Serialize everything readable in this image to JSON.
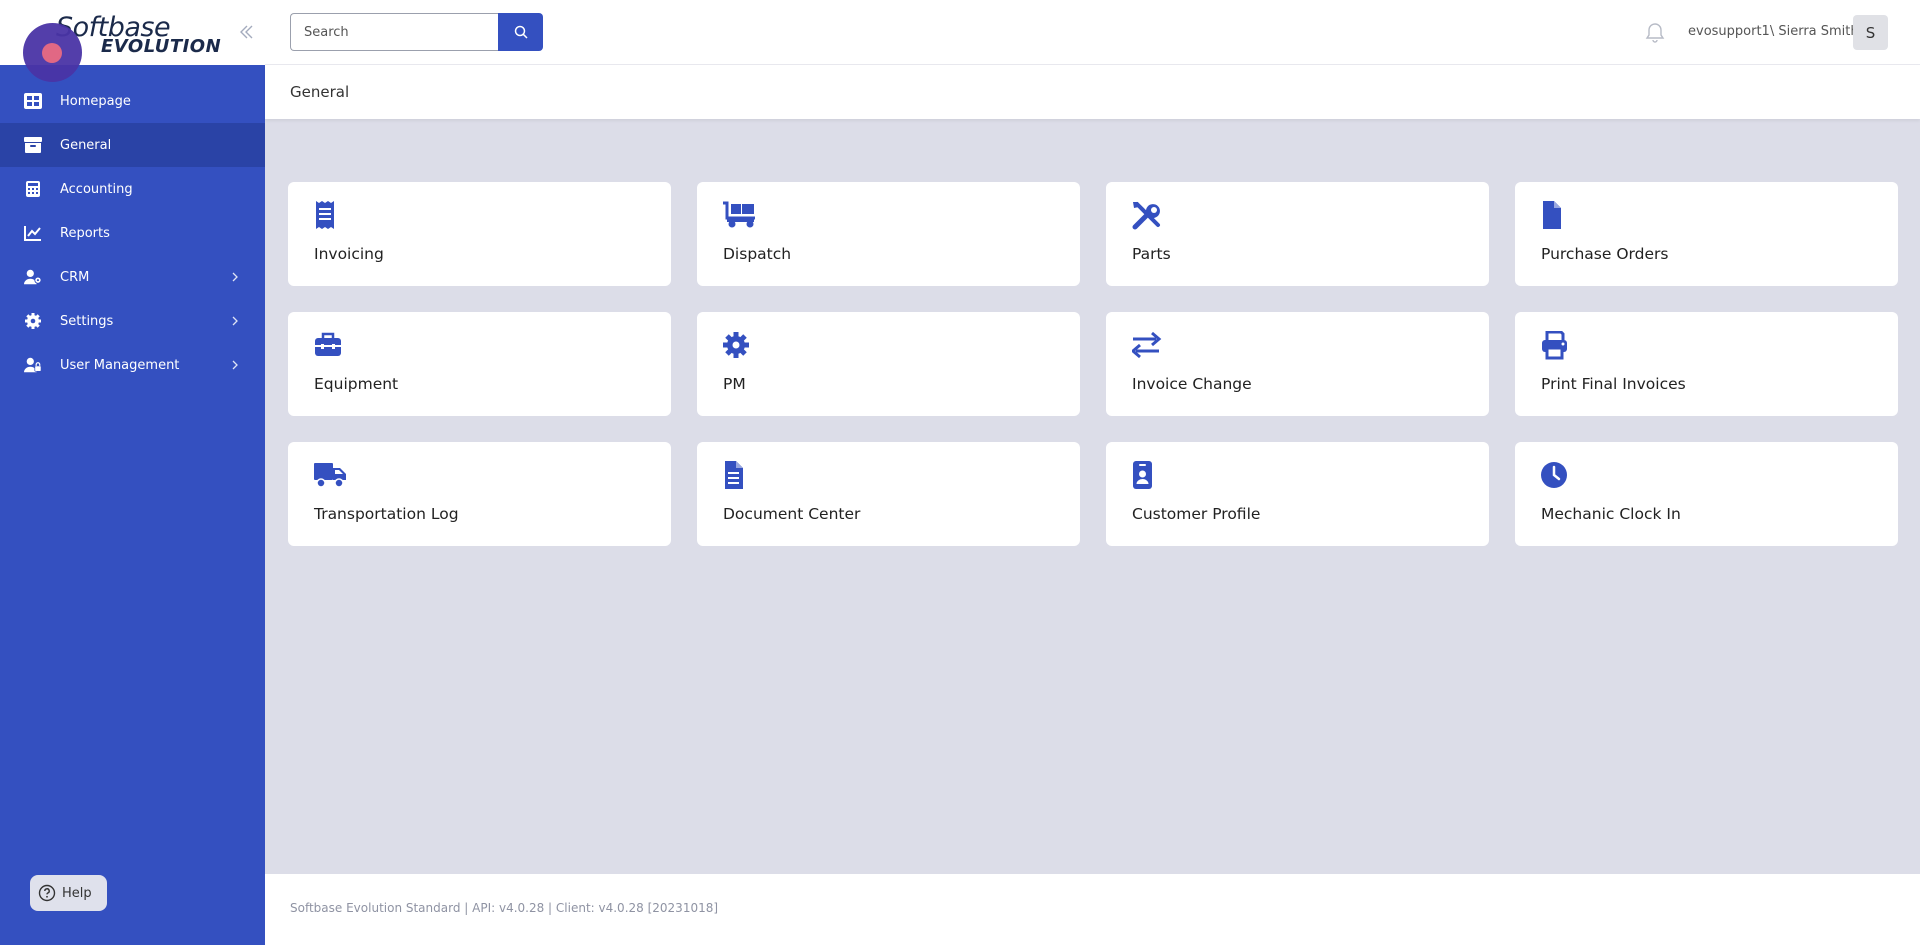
{
  "brand": {
    "logo_line1": "Softbase",
    "logo_line2": "EVOLUTION"
  },
  "sidebar": {
    "items": [
      {
        "label": "Homepage",
        "icon": "dashboard-icon",
        "active": false,
        "has_children": false
      },
      {
        "label": "General",
        "icon": "archive-box-icon",
        "active": true,
        "has_children": false
      },
      {
        "label": "Accounting",
        "icon": "calculator-icon",
        "active": false,
        "has_children": false
      },
      {
        "label": "Reports",
        "icon": "chart-line-icon",
        "active": false,
        "has_children": false
      },
      {
        "label": "CRM",
        "icon": "user-gear-icon",
        "active": false,
        "has_children": true
      },
      {
        "label": "Settings",
        "icon": "gear-icon",
        "active": false,
        "has_children": true
      },
      {
        "label": "User Management",
        "icon": "user-lock-icon",
        "active": false,
        "has_children": true
      }
    ],
    "help_label": "Help"
  },
  "header": {
    "search_placeholder": "Search",
    "user_name": "evosupport1\\ Sierra Smith",
    "avatar_initial": "S"
  },
  "page": {
    "title": "General"
  },
  "tiles": [
    {
      "label": "Invoicing",
      "icon": "receipt-icon"
    },
    {
      "label": "Dispatch",
      "icon": "dolly-icon"
    },
    {
      "label": "Parts",
      "icon": "tools-icon"
    },
    {
      "label": "Purchase Orders",
      "icon": "file-icon"
    },
    {
      "label": "Equipment",
      "icon": "toolbox-icon"
    },
    {
      "label": "PM",
      "icon": "gear-icon"
    },
    {
      "label": "Invoice Change",
      "icon": "exchange-icon"
    },
    {
      "label": "Print Final Invoices",
      "icon": "print-icon"
    },
    {
      "label": "Transportation Log",
      "icon": "truck-icon"
    },
    {
      "label": "Document Center",
      "icon": "document-lines-icon"
    },
    {
      "label": "Customer Profile",
      "icon": "id-badge-icon"
    },
    {
      "label": "Mechanic Clock In",
      "icon": "clock-icon"
    }
  ],
  "footer": {
    "text": "Softbase Evolution Standard | API: v4.0.28 | Client: v4.0.28 [20231018]"
  },
  "colors": {
    "primary": "#3450c0",
    "active_nav": "#2a43a6",
    "background": "#dcdde8",
    "tile_icon": "#3450c0"
  }
}
